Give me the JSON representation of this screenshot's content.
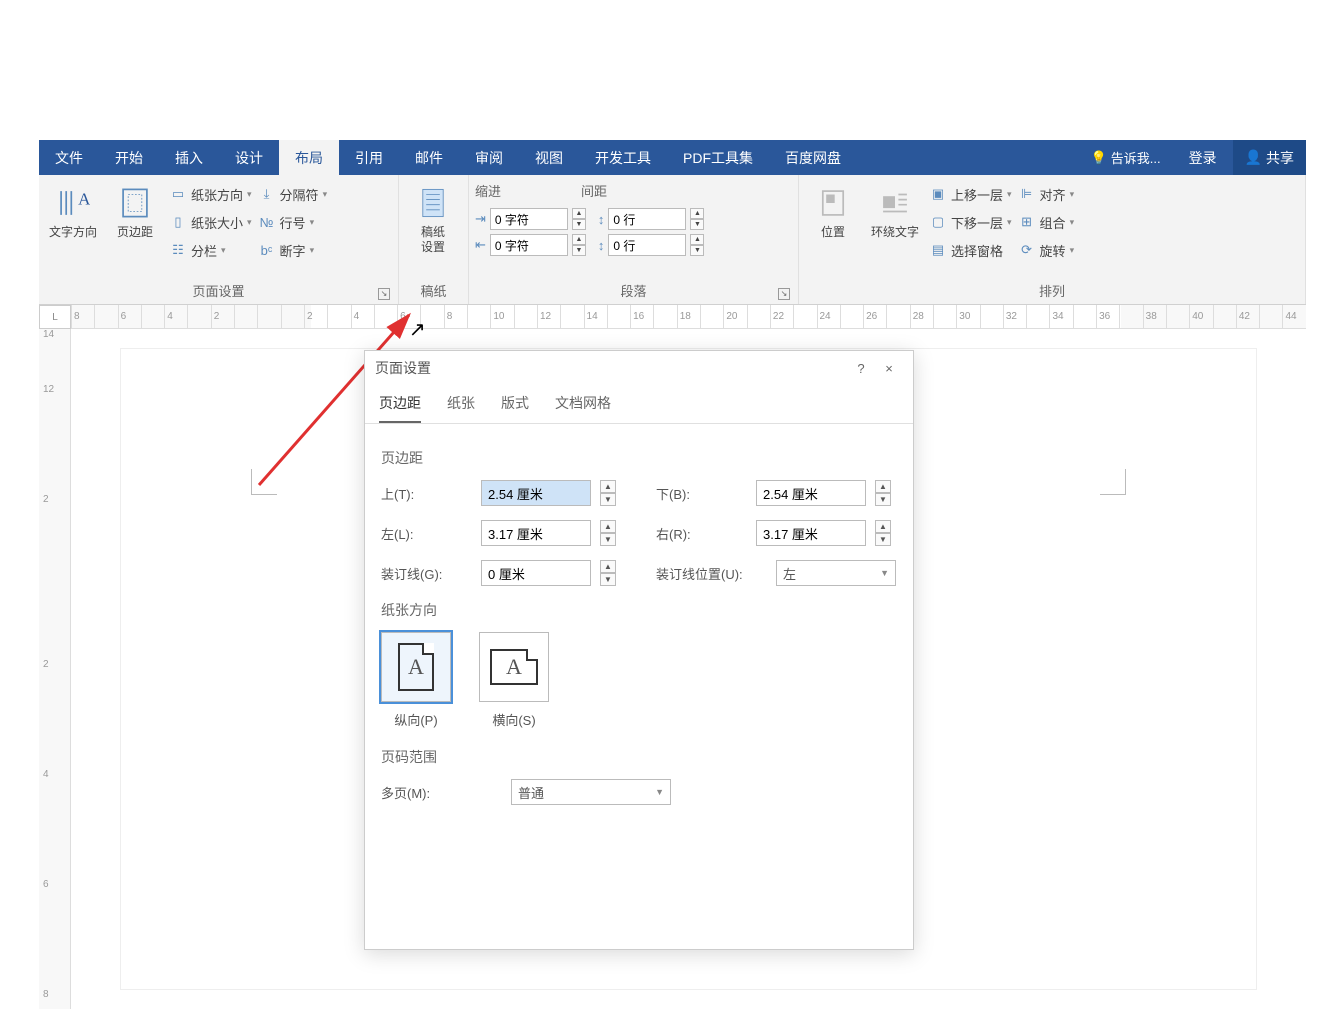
{
  "ribbon_tabs": {
    "file": "文件",
    "home": "开始",
    "insert": "插入",
    "design": "设计",
    "layout": "布局",
    "references": "引用",
    "mailings": "邮件",
    "review": "审阅",
    "view": "视图",
    "developer": "开发工具",
    "pdf": "PDF工具集",
    "baidu": "百度网盘",
    "tellme": "告诉我...",
    "login": "登录",
    "share": "共享"
  },
  "ribbon": {
    "page_setup": {
      "text_direction": "文字方向",
      "margins": "页边距",
      "orientation": "纸张方向",
      "size": "纸张大小",
      "columns": "分栏",
      "breaks": "分隔符",
      "line_numbers": "行号",
      "hyphenation": "断字",
      "group_label": "页面设置"
    },
    "manuscript": {
      "settings": "稿纸\n设置",
      "group_label": "稿纸"
    },
    "paragraph": {
      "indent_label": "缩进",
      "indent_left": "0 字符",
      "indent_right": "0 字符",
      "spacing_label": "间距",
      "spacing_before": "0 行",
      "spacing_after": "0 行",
      "group_label": "段落"
    },
    "arrange": {
      "position": "位置",
      "wrap": "环绕文字",
      "up": "上移一层",
      "down": "下移一层",
      "selection_pane": "选择窗格",
      "align": "对齐",
      "group": "组合",
      "rotate": "旋转",
      "group_label": "排列"
    }
  },
  "ruler": {
    "corner": "L",
    "marks": [
      "8",
      "",
      "6",
      "",
      "4",
      "",
      "2",
      "",
      "",
      "",
      "2",
      "",
      "4",
      "",
      "6",
      "",
      "8",
      "",
      "10",
      "",
      "12",
      "",
      "14",
      "",
      "16",
      "",
      "18",
      "",
      "20",
      "",
      "22",
      "",
      "24",
      "",
      "26",
      "",
      "28",
      "",
      "30",
      "",
      "32",
      "",
      "34",
      "",
      "36",
      "",
      "38",
      "",
      "40",
      "",
      "42",
      "",
      "44"
    ]
  },
  "v_ruler": [
    "14",
    "12",
    "",
    "2",
    "",
    "",
    "2",
    "",
    "4",
    "",
    "6",
    "",
    "8"
  ],
  "dialog": {
    "title": "页面设置",
    "help": "?",
    "close": "×",
    "tabs": {
      "margins": "页边距",
      "paper": "纸张",
      "layout": "版式",
      "grid": "文档网格"
    },
    "section_margins": "页边距",
    "top_label": "上(T):",
    "top_value": "2.54 厘米",
    "bottom_label": "下(B):",
    "bottom_value": "2.54 厘米",
    "left_label": "左(L):",
    "left_value": "3.17 厘米",
    "right_label": "右(R):",
    "right_value": "3.17 厘米",
    "gutter_label": "装订线(G):",
    "gutter_value": "0 厘米",
    "gutter_pos_label": "装订线位置(U):",
    "gutter_pos_value": "左",
    "section_orientation": "纸张方向",
    "portrait": "纵向(P)",
    "landscape": "横向(S)",
    "section_range": "页码范围",
    "multipage_label": "多页(M):",
    "multipage_value": "普通"
  }
}
